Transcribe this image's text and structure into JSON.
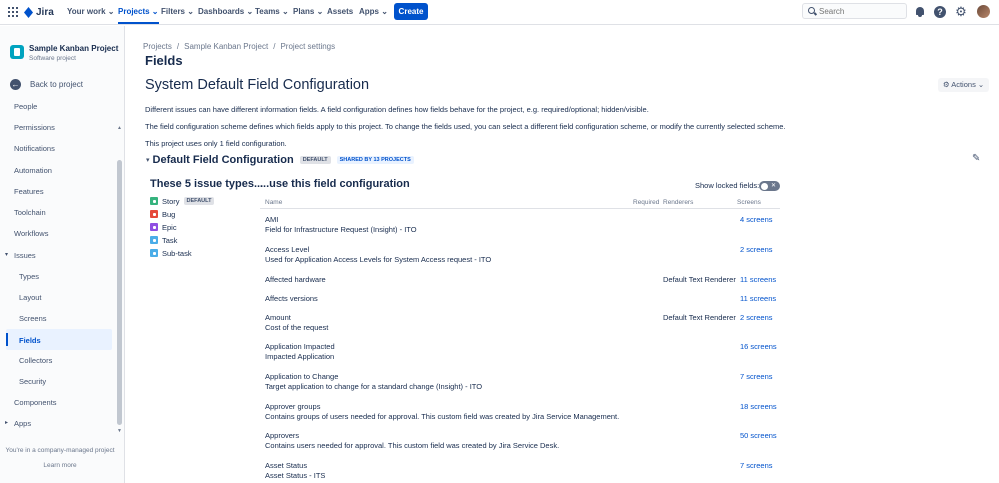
{
  "topnav": {
    "logo": "Jira",
    "items": [
      {
        "label": "Your work ⌄",
        "active": false
      },
      {
        "label": "Projects ⌄",
        "active": true
      },
      {
        "label": "Filters ⌄",
        "active": false
      },
      {
        "label": "Dashboards ⌄",
        "active": false
      },
      {
        "label": "Teams ⌄",
        "active": false
      },
      {
        "label": "Plans ⌄",
        "active": false
      },
      {
        "label": "Assets",
        "active": false
      },
      {
        "label": "Apps ⌄",
        "active": false
      }
    ],
    "create_label": "Create",
    "search_placeholder": "Search"
  },
  "sidebar": {
    "project_name": "Sample Kanban Project",
    "project_type": "Software project",
    "back_label": "Back to project",
    "items": [
      {
        "label": "People"
      },
      {
        "label": "Permissions"
      },
      {
        "label": "Notifications"
      },
      {
        "label": "Automation"
      },
      {
        "label": "Features"
      },
      {
        "label": "Toolchain"
      },
      {
        "label": "Workflows"
      },
      {
        "label": "Issues"
      },
      {
        "label": "Types"
      },
      {
        "label": "Layout"
      },
      {
        "label": "Screens"
      },
      {
        "label": "Fields"
      },
      {
        "label": "Collectors"
      },
      {
        "label": "Security"
      },
      {
        "label": "Components"
      },
      {
        "label": "Apps"
      }
    ],
    "company_note": "You're in a company-managed project",
    "learn_more": "Learn more"
  },
  "breadcrumb": [
    "Projects",
    "Sample Kanban Project",
    "Project settings"
  ],
  "page_heading": "Fields",
  "config_title": "System Default Field Configuration",
  "actions_label": "Actions ⌄",
  "paragraphs": [
    "Different issues can have different information fields. A field configuration defines how fields behave for the project, e.g. required/optional; hidden/visible.",
    "The field configuration scheme defines which fields apply to this project. To change the fields used, you can select a different field configuration scheme, or modify the currently selected scheme.",
    "This project uses only 1 field configuration."
  ],
  "configuration": {
    "name": "Default Field Configuration",
    "default_lozenge": "DEFAULT",
    "shared_lozenge": "SHARED BY 13 PROJECTS"
  },
  "issue_types_heading": "These 5 issue types...",
  "fields_heading": "...use this field configuration",
  "issue_types": [
    {
      "label": "Story",
      "badge": "DEFAULT",
      "icon": "story-icon"
    },
    {
      "label": "Bug",
      "badge": "",
      "icon": "bug-icon"
    },
    {
      "label": "Epic",
      "badge": "",
      "icon": "epic-icon"
    },
    {
      "label": "Task",
      "badge": "",
      "icon": "task-icon"
    },
    {
      "label": "Sub-task",
      "badge": "",
      "icon": "subtask-icon"
    }
  ],
  "show_locked_label": "Show locked fields:",
  "table_headers": {
    "name": "Name",
    "required": "Required",
    "renderers": "Renderers",
    "screens": "Screens"
  },
  "fields": [
    {
      "name": "AMI",
      "description": "Field for Infrastructure Request (Insight) - ITO",
      "renderer": "",
      "screens": "4 screens"
    },
    {
      "name": "Access Level",
      "description": "Used for Application Access Levels for System Access request - ITO",
      "renderer": "",
      "screens": "2 screens"
    },
    {
      "name": "Affected hardware",
      "description": "",
      "renderer": "Default Text Renderer",
      "screens": "11 screens"
    },
    {
      "name": "Affects versions",
      "description": "",
      "renderer": "",
      "screens": "11 screens"
    },
    {
      "name": "Amount",
      "description": "Cost of the request",
      "renderer": "Default Text Renderer",
      "screens": "2 screens"
    },
    {
      "name": "Application Impacted",
      "description": "Impacted Application",
      "renderer": "",
      "screens": "16 screens"
    },
    {
      "name": "Application to Change",
      "description": "Target application to change for a standard change (Insight) - ITO",
      "renderer": "",
      "screens": "7 screens"
    },
    {
      "name": "Approver groups",
      "description": "Contains groups of users needed for approval. This custom field was created by Jira Service Management.",
      "renderer": "",
      "screens": "18 screens"
    },
    {
      "name": "Approvers",
      "description": "Contains users needed for approval. This custom field was created by Jira Service Desk.",
      "renderer": "",
      "screens": "50 screens"
    },
    {
      "name": "Asset Status",
      "description": "Asset Status - ITS",
      "renderer": "",
      "screens": "7 screens"
    }
  ],
  "colors": {
    "primary": "#0052cc",
    "text": "#172b4d",
    "subtle": "#6b778c",
    "sidebar_bg": "#fafbfc"
  }
}
